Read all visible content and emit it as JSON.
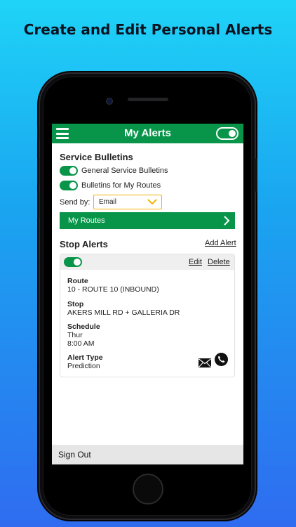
{
  "headline": "Create and Edit Personal Alerts",
  "app": {
    "title": "My Alerts",
    "icons": {
      "menu": "hamburger-icon",
      "master_toggle": "toggle-on-icon"
    }
  },
  "service_bulletins": {
    "title": "Service Bulletins",
    "items": [
      {
        "label": "General Service Bulletins",
        "enabled": true
      },
      {
        "label": "Bulletins for My Routes",
        "enabled": true
      }
    ],
    "send_by_label": "Send by:",
    "send_by_value": "Email",
    "my_routes_label": "My Routes"
  },
  "stop_alerts": {
    "title": "Stop Alerts",
    "add_label": "Add Alert",
    "alert": {
      "enabled": true,
      "edit_label": "Edit",
      "delete_label": "Delete",
      "route_label": "Route",
      "route_value": "10 - ROUTE 10 (INBOUND)",
      "stop_label": "Stop",
      "stop_value": "AKERS MILL RD + GALLERIA DR",
      "schedule_label": "Schedule",
      "schedule_day": "Thur",
      "schedule_time": "8:00 AM",
      "alert_type_label": "Alert Type",
      "alert_type_value": "Prediction",
      "icons": [
        "email-icon",
        "phone-icon"
      ]
    }
  },
  "footer": {
    "sign_out_label": "Sign Out"
  },
  "colors": {
    "brand_green": "#08954a",
    "select_border": "#f0b400"
  }
}
